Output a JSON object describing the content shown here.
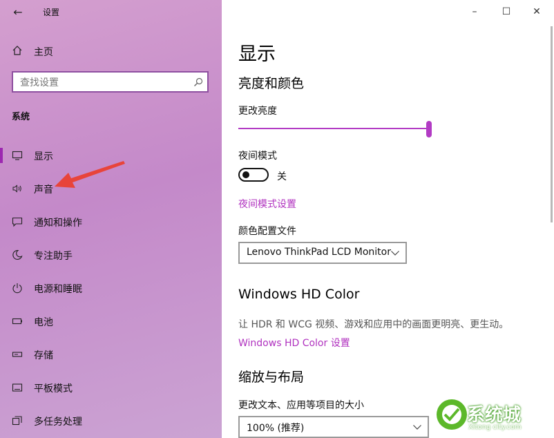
{
  "window": {
    "title": "设置",
    "controls": {
      "minimize": "–",
      "maximize": "☐",
      "close": "✕"
    }
  },
  "sidebar": {
    "home_label": "主页",
    "search_placeholder": "查找设置",
    "section_title": "系统",
    "items": [
      {
        "label": "显示",
        "icon": "monitor-icon",
        "selected": true
      },
      {
        "label": "声音",
        "icon": "speaker-icon"
      },
      {
        "label": "通知和操作",
        "icon": "message-icon"
      },
      {
        "label": "专注助手",
        "icon": "moon-icon"
      },
      {
        "label": "电源和睡眠",
        "icon": "power-icon"
      },
      {
        "label": "电池",
        "icon": "battery-icon"
      },
      {
        "label": "存储",
        "icon": "storage-icon"
      },
      {
        "label": "平板模式",
        "icon": "tablet-icon"
      },
      {
        "label": "多任务处理",
        "icon": "multitask-icon"
      }
    ]
  },
  "main": {
    "page_title": "显示",
    "brightness_heading": "亮度和颜色",
    "brightness_label": "更改亮度",
    "brightness_value": 1.0,
    "night_mode_label": "夜间模式",
    "night_mode_state": "关",
    "night_mode_link": "夜间模式设置",
    "color_profile_label": "颜色配置文件",
    "color_profile_value": "Lenovo ThinkPad LCD Monitor",
    "hd_heading": "Windows HD Color",
    "hd_desc": "让 HDR 和 WCG 视频、游戏和应用中的画面更明亮、更生动。",
    "hd_link": "Windows HD Color 设置",
    "scale_heading": "缩放与布局",
    "scale_label": "更改文本、应用等项目的大小",
    "scale_value": "100% (推荐)"
  },
  "watermark": {
    "text": "系统城",
    "sub": "Xitong city.com"
  },
  "colors": {
    "accent": "#b031bf",
    "sidebar_bg": "#c98fcb"
  }
}
